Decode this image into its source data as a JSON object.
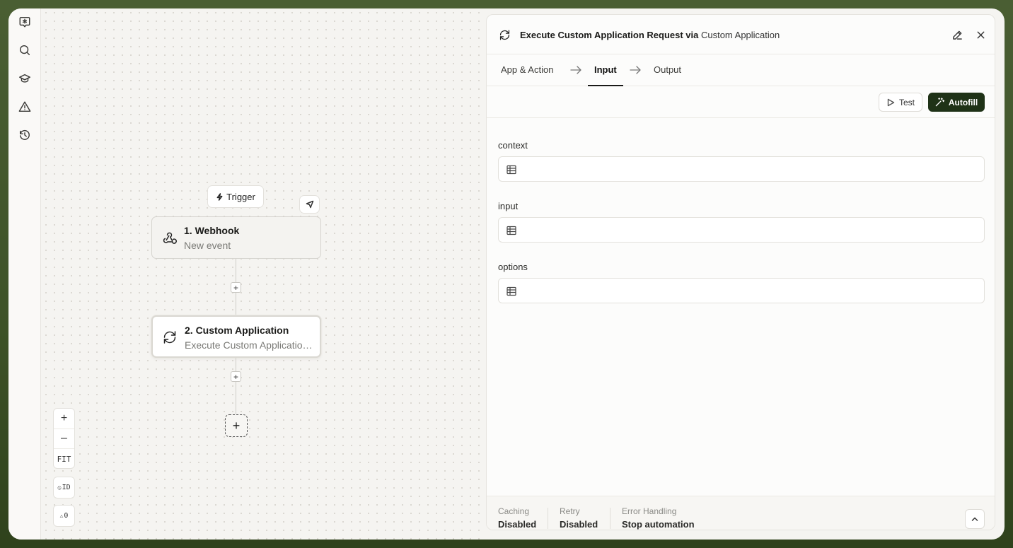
{
  "sidebar": {
    "icons": [
      "chat-asterisk-icon",
      "search-icon",
      "graduation-cap-icon",
      "warning-icon",
      "history-icon"
    ]
  },
  "canvas": {
    "trigger_label": "Trigger",
    "nodes": [
      {
        "title": "1. Webhook",
        "subtitle": "New event",
        "icon": "webhook-icon"
      },
      {
        "title": "2. Custom Application",
        "subtitle": "Execute Custom Application Request",
        "icon": "refresh-icon"
      }
    ],
    "controls": {
      "zoom_in": "+",
      "zoom_out": "–",
      "fit": "FIT",
      "id_toggle": "ID",
      "warnings_count": "0"
    }
  },
  "panel": {
    "title_prefix": "Execute Custom Application Request via ",
    "title_app": "Custom Application",
    "tabs": [
      {
        "label": "App & Action",
        "active": false
      },
      {
        "label": "Input",
        "active": true
      },
      {
        "label": "Output",
        "active": false
      }
    ],
    "test_label": "Test",
    "autofill_label": "Autofill",
    "fields": [
      {
        "label": "context",
        "value": ""
      },
      {
        "label": "input",
        "value": ""
      },
      {
        "label": "options",
        "value": ""
      }
    ],
    "footer": [
      {
        "label": "Caching",
        "value": "Disabled"
      },
      {
        "label": "Retry",
        "value": "Disabled"
      },
      {
        "label": "Error Handling",
        "value": "Stop automation"
      }
    ]
  },
  "colors": {
    "accent_dark_green": "#1f3217",
    "background_frame": "#3d5227",
    "canvas_bg": "#f5f4f1"
  }
}
